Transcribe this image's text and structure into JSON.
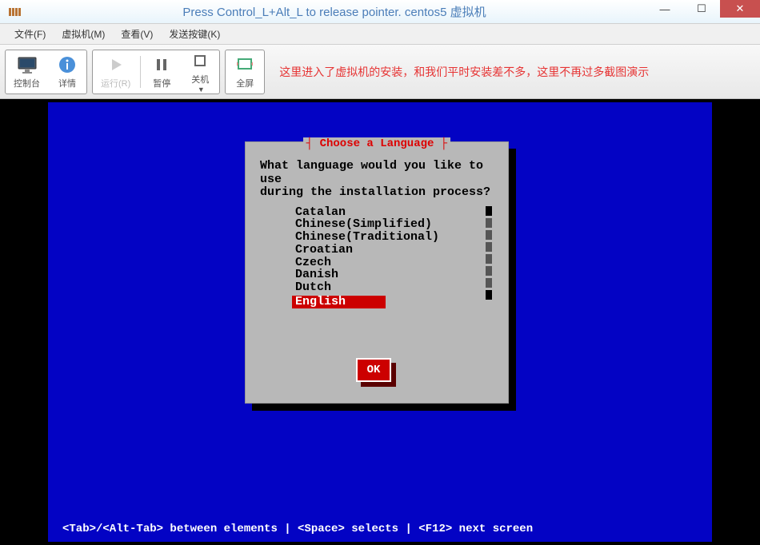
{
  "titlebar": {
    "title": "Press Control_L+Alt_L to release pointer. centos5 虚拟机"
  },
  "menubar": {
    "items": [
      "文件(F)",
      "虚拟机(M)",
      "查看(V)",
      "发送按键(K)"
    ]
  },
  "toolbar": {
    "console": "控制台",
    "details": "详情",
    "run": "运行(R)",
    "pause": "暂停",
    "shutdown": "关机",
    "fullscreen": "全屏",
    "annotation": "这里进入了虚拟机的安装，和我们平时安装差不多，这里不再过多截图演示"
  },
  "dialog": {
    "title_decor": "┤ Choose a Language ├",
    "prompt_line1": "What language would you like to use",
    "prompt_line2": "during the installation process?",
    "languages": [
      "Catalan",
      "Chinese(Simplified)",
      "Chinese(Traditional)",
      "Croatian",
      "Czech",
      "Danish",
      "Dutch",
      "English"
    ],
    "selected_index": 7,
    "ok_label": "OK"
  },
  "hints": "<Tab>/<Alt-Tab> between elements   |   <Space> selects  |   <F12> next screen"
}
